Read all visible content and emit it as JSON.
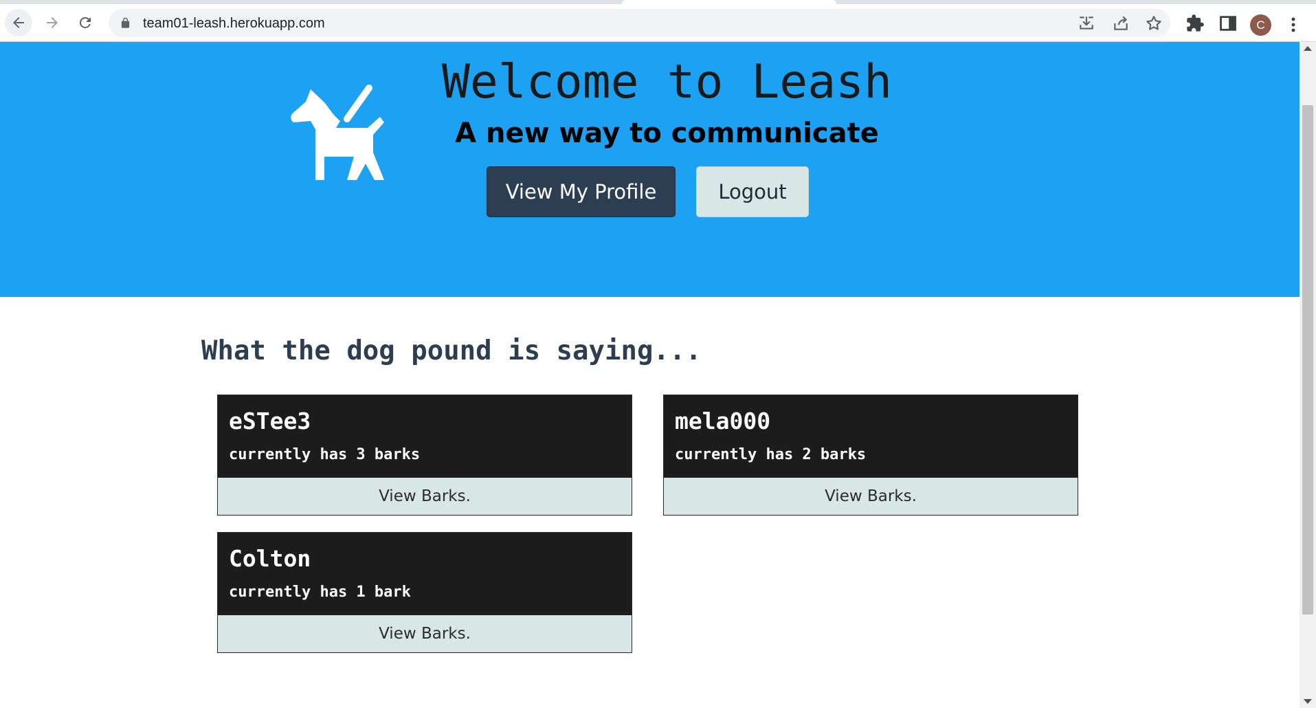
{
  "browser": {
    "url": "team01-leash.herokuapp.com",
    "profile_initial": "C",
    "icons": [
      "back-arrow-icon",
      "forward-arrow-icon",
      "reload-icon",
      "lock-icon",
      "install-icon",
      "share-icon",
      "star-icon",
      "extensions-puzzle-icon",
      "side-panel-icon",
      "kebab-menu-icon"
    ]
  },
  "hero": {
    "title": "Welcome to Leash",
    "subtitle": "A new way to communicate",
    "profile_button": "View My Profile",
    "logout_button": "Logout",
    "logo_icon": "dog-on-leash-icon",
    "background_color": "#1da1f2"
  },
  "feed": {
    "heading": "What the dog pound is saying...",
    "cards": [
      {
        "username": "eSTee3",
        "barks_text": "currently has 3 barks",
        "button": "View Barks."
      },
      {
        "username": "mela000",
        "barks_text": "currently has 2 barks",
        "button": "View Barks."
      },
      {
        "username": "Colton",
        "barks_text": "currently has 1 bark",
        "button": "View Barks."
      }
    ]
  },
  "colors": {
    "card_bg": "#1c1c1c",
    "card_footer": "#d8e7e6",
    "profile_button": "#2b3e52"
  }
}
